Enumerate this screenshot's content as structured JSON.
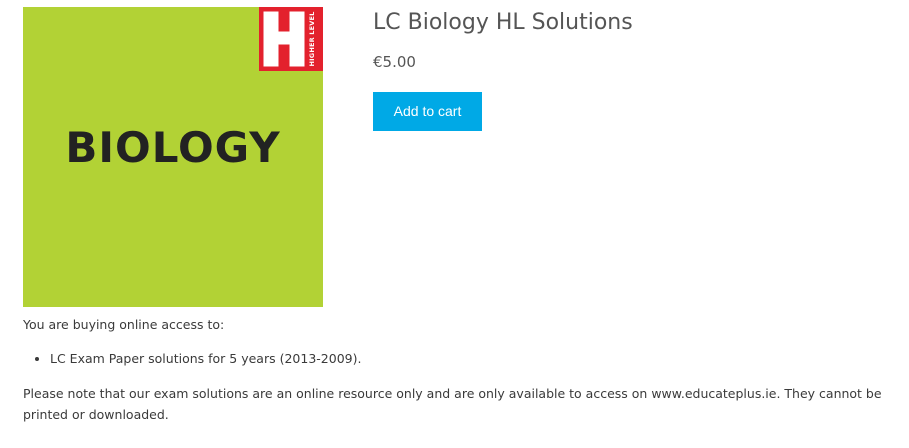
{
  "product": {
    "title": "LC Biology HL Solutions",
    "price": "€5.00",
    "add_to_cart_label": "Add to cart",
    "image": {
      "cover_word": "BIOLOGY",
      "badge_text": "HIGHER LEVEL",
      "background_color": "#b2d235",
      "badge_color": "#e3212d"
    }
  },
  "description": {
    "intro": "You are buying online access to:",
    "items": [
      "LC Exam Paper solutions for 5 years (2013-2009)."
    ],
    "note": "Please note that our exam solutions are an online resource only and are only available to access on www.educateplus.ie. They cannot be printed or downloaded."
  },
  "colors": {
    "accent": "#00a9e6",
    "title_text": "#555555",
    "body_text": "#3a3a3a"
  }
}
